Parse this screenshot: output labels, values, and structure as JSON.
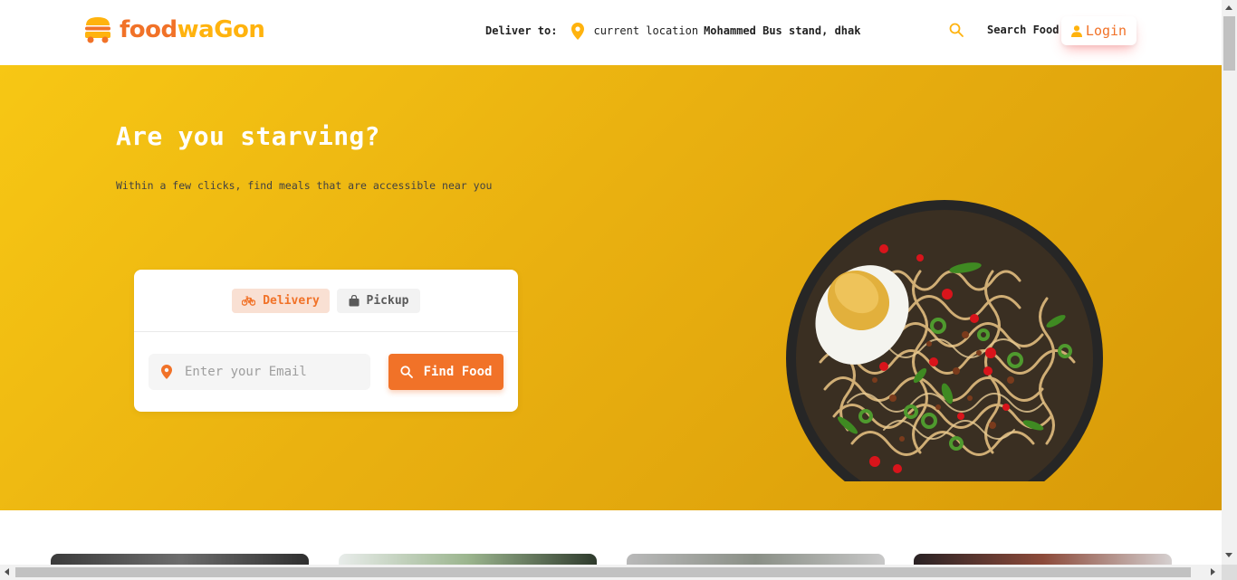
{
  "header": {
    "logo": {
      "food": "food",
      "wagon": "waGon",
      "icon": "burger-truck-icon"
    },
    "deliver_label": "Deliver to:",
    "deliver_current": "current location",
    "deliver_address": "Mohammed Bus stand, dhak",
    "search_icon": "search-icon",
    "search_label": "Search Food",
    "login_label": "Login",
    "login_icon": "user-icon"
  },
  "hero": {
    "title": "Are you starving?",
    "subtitle": "Within a few clicks, find meals that are accessible near you",
    "tabs": [
      {
        "label": "Delivery",
        "icon": "bicycle-icon",
        "active": true
      },
      {
        "label": "Pickup",
        "icon": "bag-icon",
        "active": false
      }
    ],
    "email": {
      "value": "",
      "placeholder": "Enter your Email",
      "icon": "location-pin-icon"
    },
    "find_button": {
      "label": "Find Food",
      "icon": "search-icon"
    },
    "image": "noodle-bowl-image"
  },
  "colors": {
    "brand_orange": "#f17228",
    "brand_yellow": "#ffb30e",
    "hero_gradient_start": "#f7c714",
    "hero_gradient_end": "#d89a08"
  }
}
